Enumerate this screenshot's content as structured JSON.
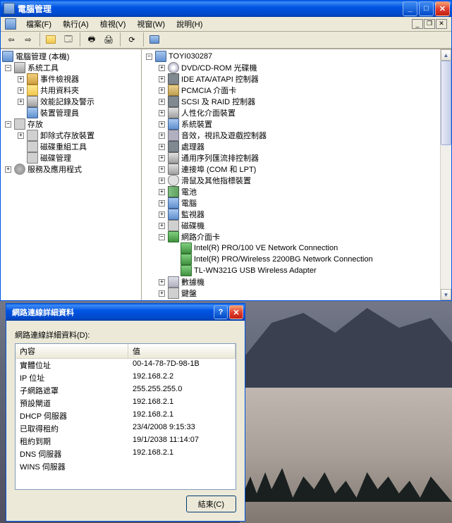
{
  "main_window": {
    "title": "電腦管理",
    "menu": {
      "file": "檔案(F)",
      "action": "執行(A)",
      "view": "檢視(V)",
      "window": "視窗(W)",
      "help": "說明(H)"
    },
    "left_tree": {
      "root": "電腦管理 (本機)",
      "system_tools": "系統工具",
      "event_viewer": "事件檢視器",
      "shared_folders": "共用資料夾",
      "perf_logs": "效能記錄及警示",
      "device_mgr": "裝置管理員",
      "storage": "存放",
      "removable": "卸除式存放裝置",
      "defrag": "磁碟重組工具",
      "disk_mgmt": "磁碟管理",
      "services": "服務及應用程式"
    },
    "right_tree": {
      "root": "TOYI030287",
      "dvd": "DVD/CD-ROM 光碟機",
      "ide": "IDE ATA/ATAPI 控制器",
      "pcmcia": "PCMCIA 介面卡",
      "scsi": "SCSI 及 RAID 控制器",
      "hid": "人性化介面裝置",
      "sys_dev": "系統裝置",
      "sound": "音效，視訊及遊戲控制器",
      "cpu": "處理器",
      "usb": "通用序列匯流排控制器",
      "ports": "連接埠 (COM 和 LPT)",
      "mouse": "滑鼠及其他指標裝置",
      "battery": "電池",
      "computer": "電腦",
      "monitor": "監視器",
      "disk": "磁碟機",
      "network": "網路介面卡",
      "net1": "Intel(R) PRO/100 VE Network Connection",
      "net2": "Intel(R) PRO/Wireless 2200BG Network Connection",
      "net3": "TL-WN321G USB Wireless Adapter",
      "modem": "數據機",
      "keyboard": "鍵盤"
    }
  },
  "dialog": {
    "title": "網路連線詳細資料",
    "label": "網路連線詳細資料(D):",
    "header": {
      "property": "內容",
      "value": "值"
    },
    "rows": [
      {
        "prop": "實體位址",
        "val": "00-14-78-7D-98-1B"
      },
      {
        "prop": "IP 位址",
        "val": "192.168.2.2"
      },
      {
        "prop": "子網路遮罩",
        "val": "255.255.255.0"
      },
      {
        "prop": "預設閘道",
        "val": "192.168.2.1"
      },
      {
        "prop": "DHCP 伺服器",
        "val": "192.168.2.1"
      },
      {
        "prop": "已取得租約",
        "val": "23/4/2008 9:15:33"
      },
      {
        "prop": "租約到期",
        "val": "19/1/2038 11:14:07"
      },
      {
        "prop": "DNS 伺服器",
        "val": "192.168.2.1"
      },
      {
        "prop": "WINS 伺服器",
        "val": ""
      }
    ],
    "close_btn": "結束(C)"
  }
}
